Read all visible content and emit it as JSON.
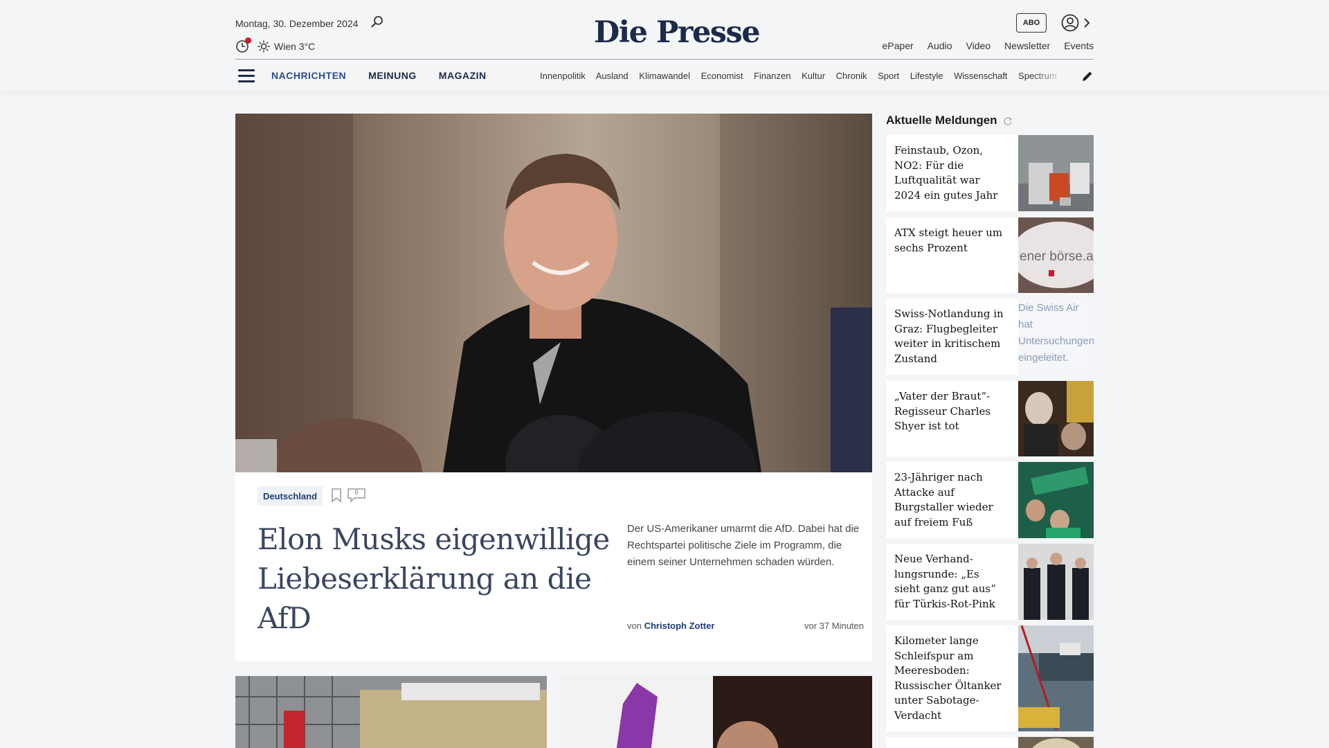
{
  "header": {
    "date": "Montag, 30. Dezember 2024",
    "weather": "Wien 3°C",
    "logo": "Die Presse",
    "abo": "ABO",
    "toplinks": [
      "ePaper",
      "Audio",
      "Video",
      "Newsletter",
      "Events"
    ]
  },
  "nav": {
    "main": [
      "NACHRICHTEN",
      "MEINUNG",
      "MAGAZIN"
    ],
    "sub": [
      "Innenpolitik",
      "Ausland",
      "Klimawandel",
      "Economist",
      "Finanzen",
      "Kultur",
      "Chronik",
      "Sport",
      "Lifestyle",
      "Wissenschaft",
      "Spectrum"
    ]
  },
  "hero": {
    "tag": "Deutschland",
    "comments": "0",
    "headline": "Elon Musks eigenwillige Liebeserklärung an die AfD",
    "teaser": "Der US-Amerikaner umarmt die AfD. Dabei hat die Rechtspartei politische Ziele im Programm, die einem seiner Unternehmen schaden würden.",
    "byline_prefix": "von",
    "author": "Christoph Zotter",
    "time": "vor 37 Minuten"
  },
  "sidebar": {
    "title": "Aktuelle Meldungen",
    "items": [
      {
        "title": "Feinstaub, Ozon, NO2: Für die Luftqualität war 2024 ein gutes Jahr"
      },
      {
        "title": "ATX steigt heuer um sechs Prozent"
      },
      {
        "title": "Swiss-Notlandung in Graz: Flugbegleiter weiter in kritischem Zustand",
        "alt": "Die Swiss Air hat Untersuchungen eingeleitet."
      },
      {
        "title": "„Vater der Braut“-Regisseur Charles Shyer ist tot"
      },
      {
        "title": "23-Jähriger nach Attacke auf Burgstaller wieder auf freiem Fuß"
      },
      {
        "title": "Neue Verhand­lungsrunde: „Es sieht ganz gut aus“ für Türkis-Rot-Pink"
      },
      {
        "title": "Kilometer lange Schleifspur am Meeresboden: Russischer Öltanker unter Sabotage-Verdacht"
      }
    ]
  },
  "image_text": {
    "boerse": "ener börse.at"
  },
  "colors": {
    "brand": "#1d2b4a",
    "link": "#1d3c78",
    "notify_dot": "#d4182a",
    "background": "#f4f5f6"
  }
}
